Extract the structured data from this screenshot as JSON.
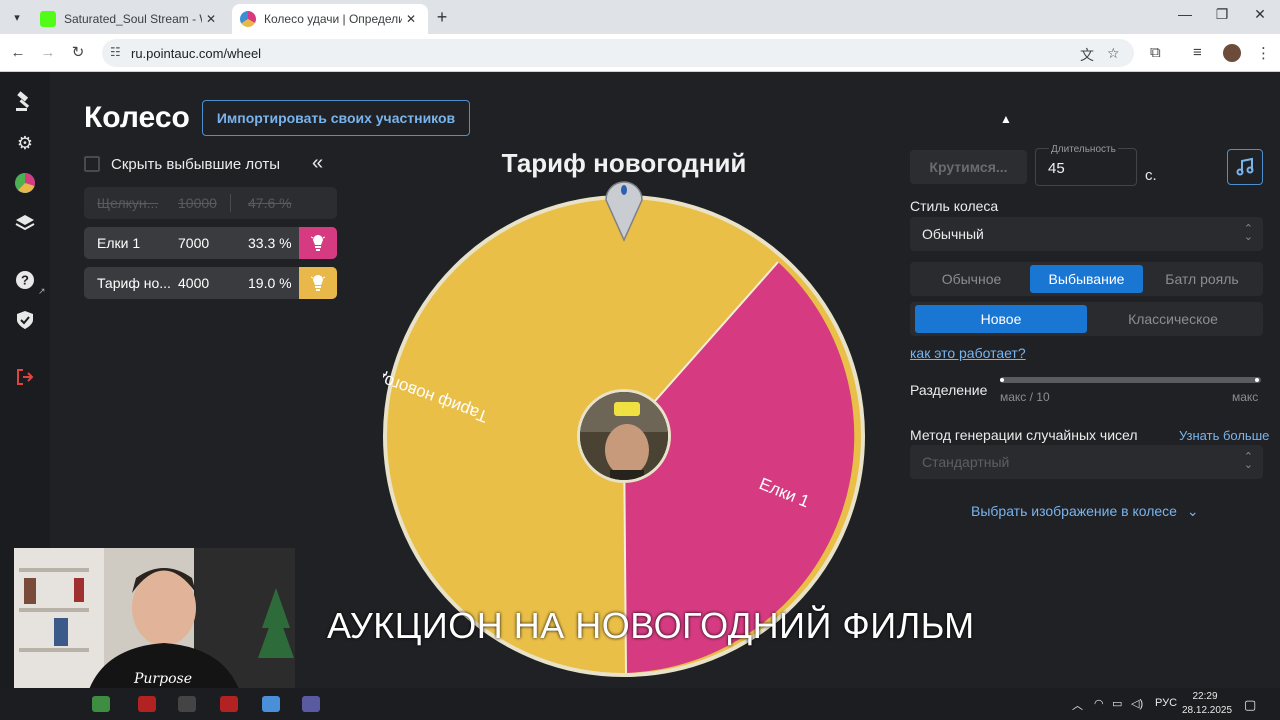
{
  "browser": {
    "tabs": [
      {
        "title": "Saturated_Soul Stream - Watch",
        "active": false
      },
      {
        "title": "Колесо удачи | Определите по",
        "active": true
      }
    ],
    "url": "ru.pointauc.com/wheel"
  },
  "page": {
    "title": "Колесо",
    "import_button": "Импортировать своих участников",
    "hide_dropped_label": "Скрыть выбывшие лоты",
    "collapse_icon": "«"
  },
  "lots": [
    {
      "name": "Щелкун...",
      "amount": "10000",
      "percent": "47.6 %",
      "dropped": true
    },
    {
      "name": "Елки 1",
      "amount": "7000",
      "percent": "33.3 %",
      "color": "#d63b82"
    },
    {
      "name": "Тариф но...",
      "amount": "4000",
      "percent": "19.0 %",
      "color": "#e8b94a"
    }
  ],
  "wheel": {
    "title": "Тариф новогодний",
    "segments": [
      {
        "label": "Тариф новогодний",
        "color": "#eabf48",
        "share": 0.625
      },
      {
        "label": "Елки 1",
        "color": "#d63b82",
        "share": 0.375
      }
    ]
  },
  "settings": {
    "spin_button": "Крутимся...",
    "duration_label": "Длительность",
    "duration_value": "45",
    "duration_unit": "с.",
    "wheel_style_label": "Стиль колеса",
    "wheel_style_value": "Обычный",
    "mode_options": [
      "Обычное",
      "Выбывание",
      "Батл рояль"
    ],
    "mode_selected": "Выбывание",
    "variant_options": [
      "Новое",
      "Классическое"
    ],
    "variant_selected": "Новое",
    "how_link": "как это работает?",
    "split_label": "Разделение",
    "split_min": "макс / 10",
    "split_max": "макс",
    "rng_label": "Метод генерации случайных чисел",
    "rng_link": "Узнать больше",
    "rng_value": "Стандартный",
    "image_link": "Выбрать изображение в колесе"
  },
  "overlay": {
    "caption": "АУКЦИОН НА НОВОГОДНИЙ ФИЛЬМ"
  },
  "taskbar": {
    "lang": "РУС",
    "time": "22:29",
    "date": "28.12.2025"
  }
}
